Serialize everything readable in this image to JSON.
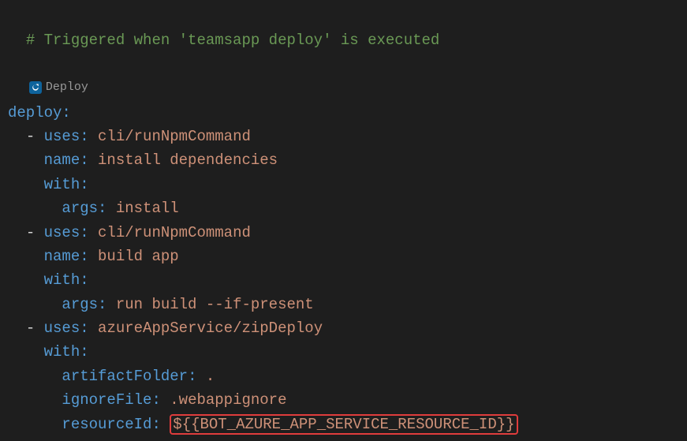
{
  "lines": {
    "comment": "# Triggered when 'teamsapp deploy' is executed",
    "codelens_label": "Deploy",
    "deploy_key": "deploy",
    "uses_key": "uses",
    "name_key": "name",
    "with_key": "with",
    "args_key": "args",
    "artifact_key": "artifactFolder",
    "ignore_key": "ignoreFile",
    "resource_key": "resourceId",
    "dash": "-",
    "colon": ":",
    "task1_uses": "cli/runNpmCommand",
    "task1_name": "install dependencies",
    "task1_args": "install",
    "task2_uses": "cli/runNpmCommand",
    "task2_name": "build app",
    "task2_args": "run build --if-present",
    "task3_uses": "azureAppService/zipDeploy",
    "task3_artifact": ".",
    "task3_ignore": ".webappignore",
    "task3_resource": "${{BOT_AZURE_APP_SERVICE_RESOURCE_ID}}"
  }
}
